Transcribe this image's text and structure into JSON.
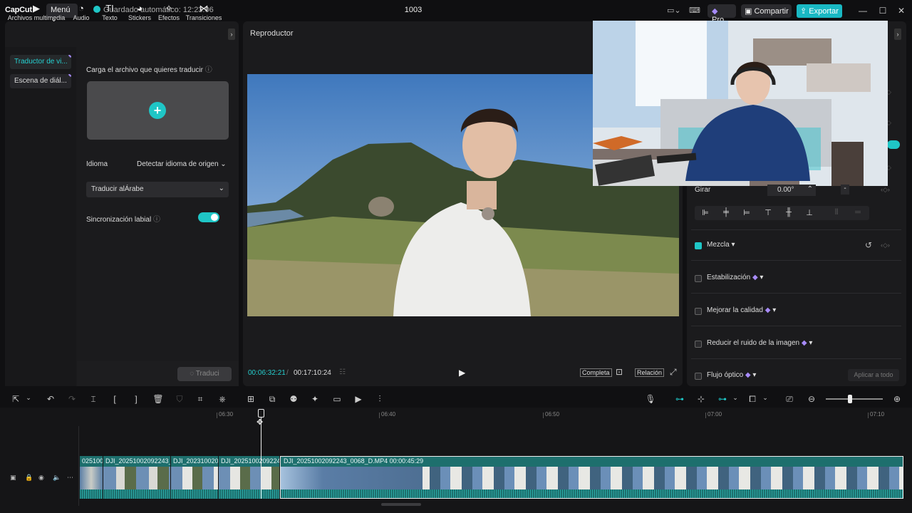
{
  "titlebar": {
    "logo": "CapCut",
    "menu": "Menú ⌄",
    "autosave": "Guardado automático: 12:23:06",
    "project_title": "1003",
    "pro": "Pro",
    "share": "Compartir",
    "export": "Exportar"
  },
  "left_tabs": [
    {
      "label": "Archivos multimedia",
      "icon": "media-icon"
    },
    {
      "label": "Audio",
      "icon": "audio-icon"
    },
    {
      "label": "Texto",
      "icon": "text-icon"
    },
    {
      "label": "Stickers",
      "icon": "sticker-icon"
    },
    {
      "label": "Efectos",
      "icon": "effects-icon"
    },
    {
      "label": "Transiciones",
      "icon": "transitions-icon"
    }
  ],
  "side_nav": [
    {
      "label": "Traductor de vi..."
    },
    {
      "label": "Escena de diál..."
    }
  ],
  "translator": {
    "upload_label": "Carga el archivo que quieres traducir",
    "language_label": "Idioma",
    "language_value": "Detectar idioma de origen",
    "translate_to": "Traducir alÁrabe",
    "lipsync_label": "Sincronización labial",
    "lipsync_on": true,
    "translate_button": "Traduci"
  },
  "player": {
    "title": "Reproductor",
    "current_time": "00:06:32:21",
    "separator": "/",
    "total_time": "00:17:10:24",
    "full_label": "Completa",
    "ratio_label": "Relación"
  },
  "properties": {
    "rotate_label": "Girar",
    "rotate_value": "0.00°",
    "rows": [
      {
        "label": "Mezcla",
        "checked": true
      },
      {
        "label": "Estabilización",
        "checked": false
      },
      {
        "label": "Mejorar la calidad",
        "checked": false
      },
      {
        "label": "Reducir el ruido de la imagen",
        "checked": false
      },
      {
        "label": "Flujo óptico",
        "checked": false
      }
    ],
    "apply_all": "Aplicar a todo"
  },
  "timeline": {
    "ticks": [
      "06:30",
      "06:40",
      "06:50",
      "07:00",
      "07:10"
    ],
    "clips": [
      {
        "name": "025100"
      },
      {
        "name": "DJI_20251002092243_("
      },
      {
        "name": "DJI_2023100209"
      },
      {
        "name": "DJI_20251002092243"
      },
      {
        "name": "DJI_20251002092243_0068_D.MP4   00:00:45:29"
      }
    ]
  },
  "colors": {
    "accent": "#1fc6c6",
    "clip": "#1d6f6d",
    "panel": "#1b1b1d"
  }
}
